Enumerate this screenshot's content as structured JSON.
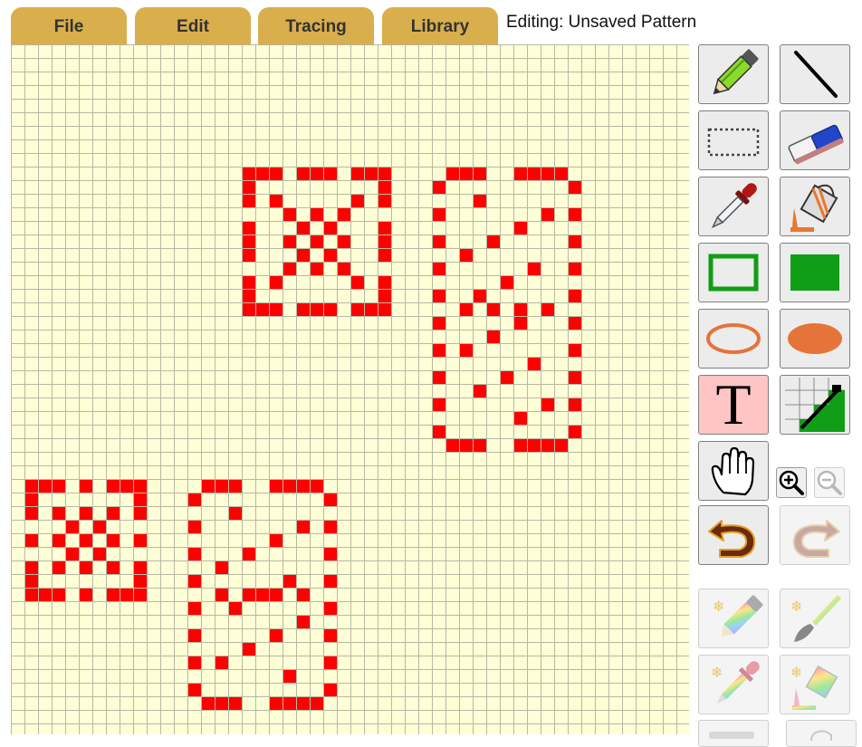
{
  "tabs": [
    {
      "label": "File"
    },
    {
      "label": "Edit"
    },
    {
      "label": "Tracing"
    },
    {
      "label": "Library"
    }
  ],
  "status": {
    "text": "Editing: Unsaved Pattern"
  },
  "colors": {
    "tab": "#d9ae4c",
    "canvas_background": "#ffffd7",
    "grid_line": "#b8b8a2",
    "stitch": "#ff0000",
    "active_tool": "#ffc4c4"
  },
  "tools": [
    {
      "name": "pencil-icon",
      "active": false
    },
    {
      "name": "line-icon",
      "active": false
    },
    {
      "name": "select-rectangle-icon",
      "active": false
    },
    {
      "name": "eraser-icon",
      "active": false
    },
    {
      "name": "eyedropper-icon",
      "active": false
    },
    {
      "name": "paint-bucket-icon",
      "active": false
    },
    {
      "name": "rectangle-outline-icon",
      "active": false
    },
    {
      "name": "rectangle-filled-icon",
      "active": false
    },
    {
      "name": "ellipse-outline-icon",
      "active": false
    },
    {
      "name": "ellipse-filled-icon",
      "active": false
    },
    {
      "name": "text-icon",
      "glyph": "T",
      "active": true
    },
    {
      "name": "stitch-line-icon",
      "active": false
    },
    {
      "name": "pan-hand-icon",
      "active": false
    },
    {
      "name": "zoom-in-icon",
      "enabled": true
    },
    {
      "name": "zoom-out-icon",
      "enabled": false
    },
    {
      "name": "undo-icon",
      "enabled": true
    },
    {
      "name": "redo-icon",
      "enabled": false
    },
    {
      "name": "rainbow-pencil-icon",
      "enabled": false
    },
    {
      "name": "rainbow-brush-icon",
      "enabled": false
    },
    {
      "name": "rainbow-eyedropper-icon",
      "enabled": false
    },
    {
      "name": "rainbow-fill-icon",
      "enabled": false
    }
  ]
}
